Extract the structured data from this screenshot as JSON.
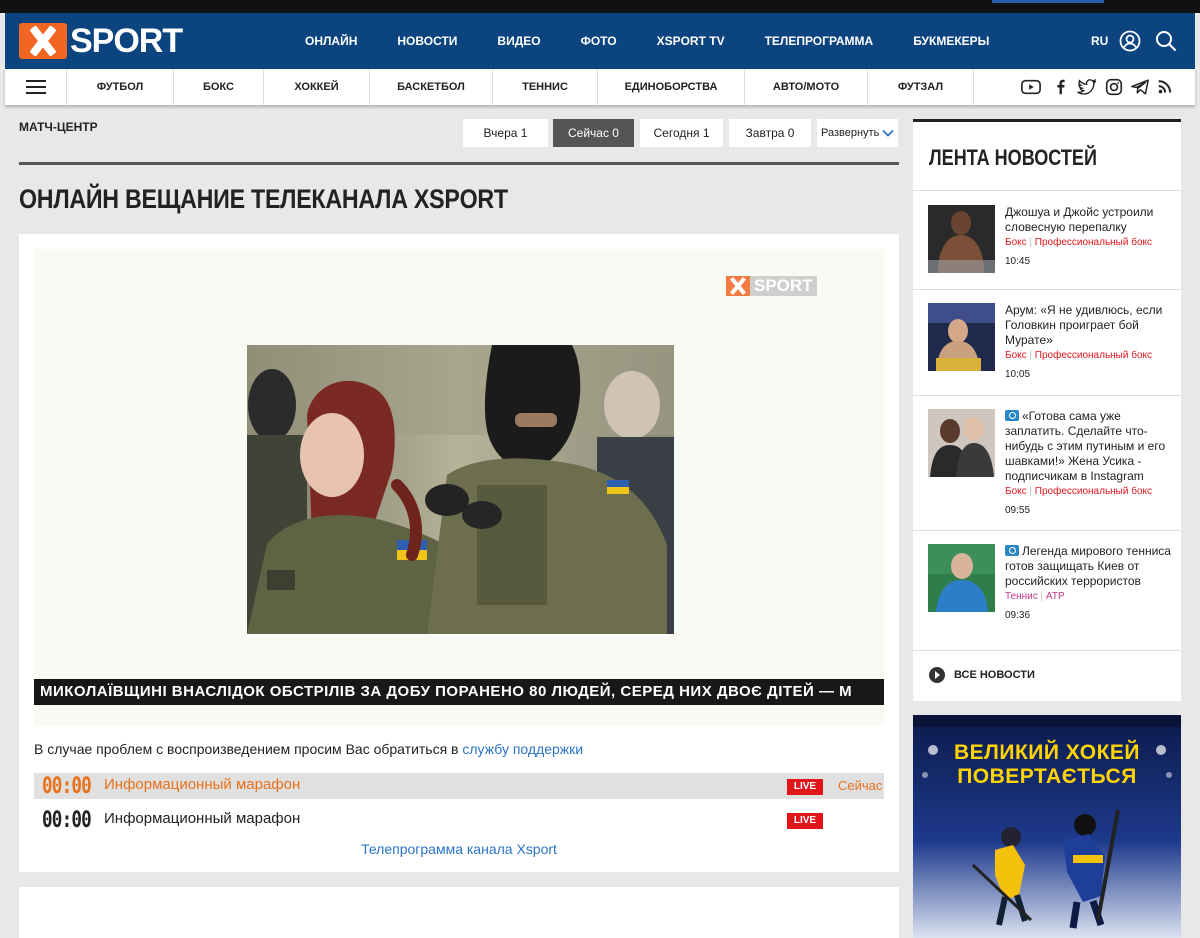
{
  "header": {
    "logo_text": "SPORT",
    "nav": [
      "ОНЛАЙН",
      "НОВОСТИ",
      "ВИДЕО",
      "ФОТО",
      "XSPORT TV",
      "ТЕЛЕПРОГРАММА",
      "БУКМЕКЕРЫ"
    ],
    "lang": "RU",
    "brand_color": "#0c447f",
    "accent_color": "#f26522"
  },
  "subnav": {
    "sports": [
      "ФУТБОЛ",
      "БОКС",
      "ХОККЕЙ",
      "БАСКЕТБОЛ",
      "ТЕННИС",
      "ЕДИНОБОРСТВА",
      "АВТО/МОТО",
      "ФУТЗАЛ"
    ],
    "social_icons": [
      "youtube-icon",
      "facebook-icon",
      "twitter-icon",
      "instagram-icon",
      "telegram-icon",
      "rss-icon"
    ]
  },
  "match_center": {
    "title": "МАТЧ-ЦЕНТР",
    "tabs": [
      "Вчера 1",
      "Сейчас 0",
      "Сегодня 1",
      "Завтра 0"
    ],
    "active_tab": "Сейчас 0",
    "expand_label": "Развернуть"
  },
  "page_title": "ОНЛАЙН ВЕЩАНИЕ ТЕЛЕКАНАЛА XSPORT",
  "player": {
    "watermark": "SPORT",
    "ticker": "МИКОЛАЇВЩИНІ ВНАСЛІДОК ОБСТРІЛІВ ЗА ДОБУ ПОРАНЕНО 80 ЛЮДЕЙ, СЕРЕД НИХ ДВОЄ ДІТЕЙ — М",
    "support_text": "В случае проблем с воспроизведением просим Вас обратиться в",
    "support_link": "службу поддержки"
  },
  "schedule": [
    {
      "time": "00:00",
      "name": "Информационный марафон",
      "badge": "LIVE",
      "status": "Сейчас"
    },
    {
      "time": "00:00",
      "name": "Информационный марафон",
      "badge": "LIVE",
      "status": ""
    }
  ],
  "tvprogram_link": "Телепрограмма канала Xsport",
  "feed": {
    "title": "ЛЕНТА НОВОСТЕЙ",
    "items": [
      {
        "title": "Джошуа и Джойс устроили словесную перепалку",
        "tag1": "Бокс",
        "tag2": "Профессиональный бокс",
        "time": "10:45",
        "has_camera": false
      },
      {
        "title": "Арум: «Я не удивлюсь, если Головкин проиграет бой Мурате»",
        "tag1": "Бокс",
        "tag2": "Профессиональный бокс",
        "time": "10:05",
        "has_camera": false
      },
      {
        "title": "«Готова сама уже заплатить. Сделайте что-нибудь с этим путиным и его шавками!» Жена Усика - подписчикам в Instagram",
        "tag1": "Бокс",
        "tag2": "Профессиональный бокс",
        "time": "09:55",
        "has_camera": true
      },
      {
        "title": "Легенда мирового тенниса готов защищать Киев от российских террористов",
        "tag1": "Теннис",
        "tag2": "ATP",
        "time": "09:36",
        "has_camera": true
      }
    ],
    "all_news": "ВСЕ НОВОСТИ"
  },
  "ad": {
    "line1": "ВЕЛИКИЙ ХОКЕЙ",
    "line2": "ПОВЕРТАЄТЬСЯ"
  }
}
